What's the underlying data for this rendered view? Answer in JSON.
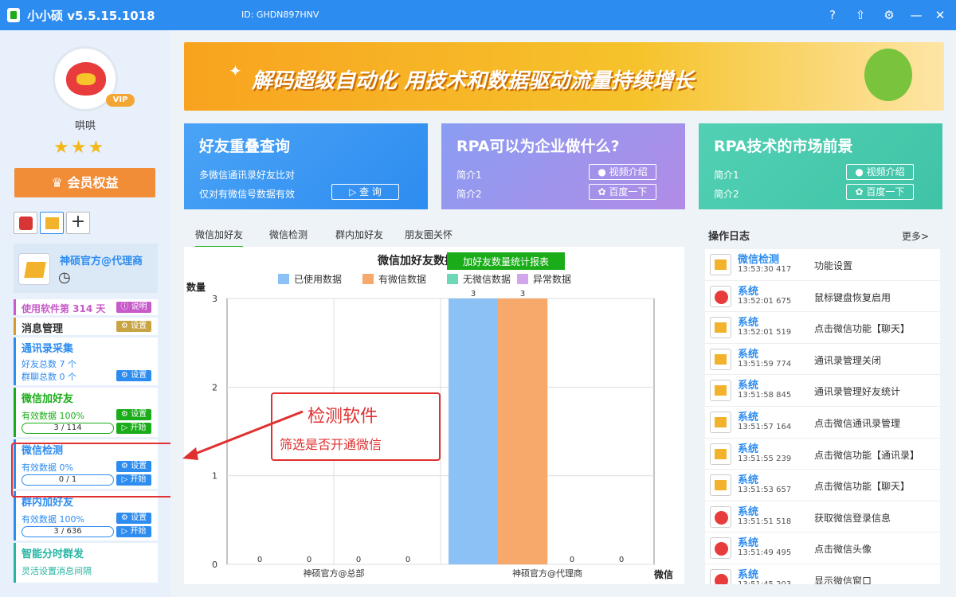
{
  "titlebar": {
    "app": "小小硕  v5.5.15.1018",
    "uid": "ID: GHDN897HNV"
  },
  "user": {
    "name": "哄哄",
    "vip": "VIP",
    "stars": "★★★",
    "member_btn": "会员权益"
  },
  "agent": {
    "title": "神硕官方@代理商"
  },
  "sidebar": {
    "usage": "使用软件第 314 天",
    "usage_btn": "说明",
    "msg_mgmt": "消息管理",
    "setting": "设置",
    "start": "开始",
    "contacts": {
      "title": "通讯录采集",
      "friends": "好友总数 7 个",
      "groups": "群聊总数 0 个"
    },
    "addfriend": {
      "title": "微信加好友",
      "valid": "有效数据 100%",
      "progress": "3 / 114"
    },
    "detect": {
      "title": "微信检测",
      "valid": "有效数据 0%",
      "progress": "0 / 1"
    },
    "group_add": {
      "title": "群内加好友",
      "valid": "有效数据 100%",
      "progress": "3 / 636"
    },
    "smart": {
      "title": "智能分时群发",
      "desc": "灵活设置消息间隔"
    }
  },
  "banner": {
    "text": "解码超级自动化 用技术和数据驱动流量持续增长"
  },
  "cards": [
    {
      "title": "好友重叠查询",
      "l1": "多微信通讯录好友比对",
      "l2": "仅对有微信号数据有效",
      "btn": "查 询"
    },
    {
      "title": "RPA可以为企业做什么?",
      "l1": "简介1",
      "l2": "简介2",
      "btn1": "视频介绍",
      "btn2": "百度一下"
    },
    {
      "title": "RPA技术的市场前景",
      "l1": "简介1",
      "l2": "简介2",
      "btn1": "视频介绍",
      "btn2": "百度一下"
    }
  ],
  "tabs": [
    "微信加好友",
    "微信检测",
    "群内加好友",
    "朋友圈关怀"
  ],
  "chart_btn": "加好友数量统计报表",
  "chart_data": {
    "type": "bar",
    "title": "微信加好友数据统计",
    "ylabel": "数量",
    "xlabel": "微信",
    "ylim": [
      0,
      3
    ],
    "yticks": [
      0,
      1,
      2,
      3
    ],
    "categories": [
      "神硕官方@总部",
      "神硕官方@代理商"
    ],
    "series": [
      {
        "name": "已使用数据",
        "color": "#8cc1f5",
        "values": [
          0,
          3
        ]
      },
      {
        "name": "有微信数据",
        "color": "#f6a96b",
        "values": [
          0,
          3
        ]
      },
      {
        "name": "无微信数据",
        "color": "#6ed7b8",
        "values": [
          0,
          0
        ]
      },
      {
        "name": "异常数据",
        "color": "#d1a6ea",
        "values": [
          0,
          0
        ]
      }
    ]
  },
  "log": {
    "title": "操作日志",
    "more": "更多>",
    "rows": [
      {
        "type": "app",
        "name": "微信检测",
        "time": "13:53:30 417",
        "action": "功能设置"
      },
      {
        "type": "sys",
        "name": "系统",
        "time": "13:52:01 675",
        "action": "鼠标键盘恢复启用"
      },
      {
        "type": "app",
        "name": "系统",
        "time": "13:52:01 519",
        "action": "点击微信功能【聊天】"
      },
      {
        "type": "app",
        "name": "系统",
        "time": "13:51:59 774",
        "action": "通讯录管理关闭"
      },
      {
        "type": "app",
        "name": "系统",
        "time": "13:51:58 845",
        "action": "通讯录管理好友统计"
      },
      {
        "type": "app",
        "name": "系统",
        "time": "13:51:57 164",
        "action": "点击微信通讯录管理"
      },
      {
        "type": "app",
        "name": "系统",
        "time": "13:51:55 239",
        "action": "点击微信功能【通讯录】"
      },
      {
        "type": "app",
        "name": "系统",
        "time": "13:51:53 657",
        "action": "点击微信功能【聊天】"
      },
      {
        "type": "sys",
        "name": "系统",
        "time": "13:51:51 518",
        "action": "获取微信登录信息"
      },
      {
        "type": "sys",
        "name": "系统",
        "time": "13:51:49 495",
        "action": "点击微信头像"
      },
      {
        "type": "sys",
        "name": "系统",
        "time": "13:51:45 203",
        "action": "显示微信窗口"
      }
    ]
  },
  "annotation": {
    "title": "检测软件",
    "sub": "筛选是否开通微信"
  },
  "colors": {
    "blue": "#2d8cf0",
    "green": "#1aad19",
    "orange": "#f18c37",
    "red": "#e03030"
  }
}
